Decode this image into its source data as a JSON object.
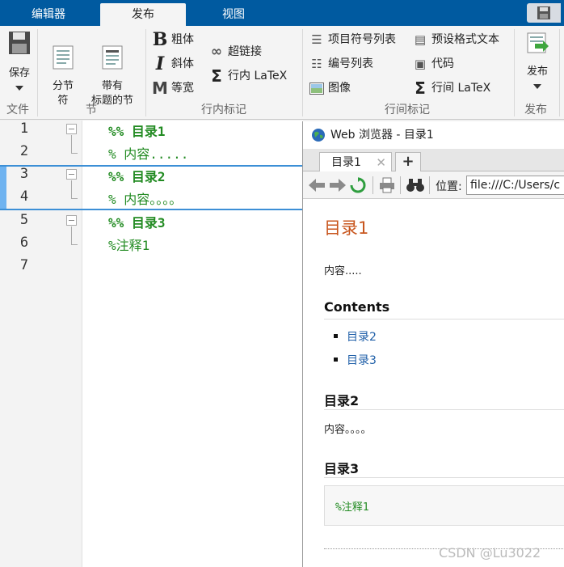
{
  "tabs": [
    "编辑器",
    "发布",
    "视图"
  ],
  "ribbon": {
    "file": {
      "save": "保存",
      "group": "文件"
    },
    "section": {
      "split": "分节\n符",
      "titled": "带有\n标题的节",
      "group": "节"
    },
    "inline": {
      "bold": "粗体",
      "italic": "斜体",
      "mono": "等宽",
      "link": "超链接",
      "latex": "行内 LaTeX",
      "group": "行内标记"
    },
    "line": {
      "bullet": "项目符号列表",
      "numbered": "编号列表",
      "image": "图像",
      "preformatted": "预设格式文本",
      "code": "代码",
      "latex": "行间 LaTeX",
      "group": "行间标记"
    },
    "publish": {
      "label": "发布",
      "group": "发布"
    }
  },
  "editor": {
    "lines": [
      "1",
      "2",
      "3",
      "4",
      "5",
      "6",
      "7"
    ],
    "code": [
      "%% 目录1",
      "% 内容.....",
      "%% 目录2",
      "% 内容。。。。",
      "%% 目录3",
      "%注释1"
    ]
  },
  "browser": {
    "title": "Web 浏览器 - 目录1",
    "tab": "目录1",
    "location_label": "位置:",
    "url": "file:///C:/Users/c",
    "h1": "目录1",
    "p1": "内容.....",
    "contents": "Contents",
    "links": [
      "目录2",
      "目录3"
    ],
    "h2a": "目录2",
    "p2": "内容。。。。",
    "h2b": "目录3",
    "comment": "%注释1"
  },
  "watermark": "CSDN @Lu3022"
}
